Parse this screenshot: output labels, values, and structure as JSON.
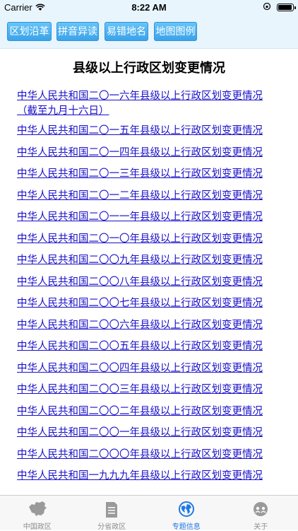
{
  "status_bar": {
    "carrier": "Carrier",
    "time": "8:22 AM"
  },
  "top_buttons": [
    {
      "label": "区划沿革"
    },
    {
      "label": "拼音异读"
    },
    {
      "label": "易错地名"
    },
    {
      "label": "地图图例"
    }
  ],
  "page": {
    "title": "县级以上行政区划变更情况"
  },
  "links": [
    {
      "text": "中华人民共和国二〇一六年县级以上行政区划变更情况（截至九月十六日）"
    },
    {
      "text": "中华人民共和国二〇一五年县级以上行政区划变更情况"
    },
    {
      "text": "中华人民共和国二〇一四年县级以上行政区划变更情况"
    },
    {
      "text": "中华人民共和国二〇一三年县级以上行政区划变更情况"
    },
    {
      "text": "中华人民共和国二〇一二年县级以上行政区划变更情况"
    },
    {
      "text": "中华人民共和国二〇一一年县级以上行政区划变更情况"
    },
    {
      "text": "中华人民共和国二〇一〇年县级以上行政区划变更情况"
    },
    {
      "text": "中华人民共和国二〇〇九年县级以上行政区划变更情况"
    },
    {
      "text": "中华人民共和国二〇〇八年县级以上行政区划变更情况"
    },
    {
      "text": "中华人民共和国二〇〇七年县级以上行政区划变更情况"
    },
    {
      "text": "中华人民共和国二〇〇六年县级以上行政区划变更情况"
    },
    {
      "text": "中华人民共和国二〇〇五年县级以上行政区划变更情况"
    },
    {
      "text": "中华人民共和国二〇〇四年县级以上行政区划变更情况"
    },
    {
      "text": "中华人民共和国二〇〇三年县级以上行政区划变更情况"
    },
    {
      "text": "中华人民共和国二〇〇二年县级以上行政区划变更情况"
    },
    {
      "text": "中华人民共和国二〇〇一年县级以上行政区划变更情况"
    },
    {
      "text": "中华人民共和国二〇〇〇年县级以上行政区划变更情况"
    },
    {
      "text": "中华人民共和国一九九九年县级以上行政区划变更情况"
    }
  ],
  "tabs": [
    {
      "label": "中国政区",
      "icon": "china-map-icon",
      "active": false
    },
    {
      "label": "分省政区",
      "icon": "document-icon",
      "active": false
    },
    {
      "label": "专题信息",
      "icon": "globe-icon",
      "active": true
    },
    {
      "label": "关于",
      "icon": "about-icon",
      "active": false
    }
  ],
  "colors": {
    "link": "#1a10c9",
    "button": "#3aa3ea",
    "tab_active": "#1e7ae6",
    "tab_inactive": "#8e8e8e",
    "header_bg": "#e8f5fd"
  }
}
